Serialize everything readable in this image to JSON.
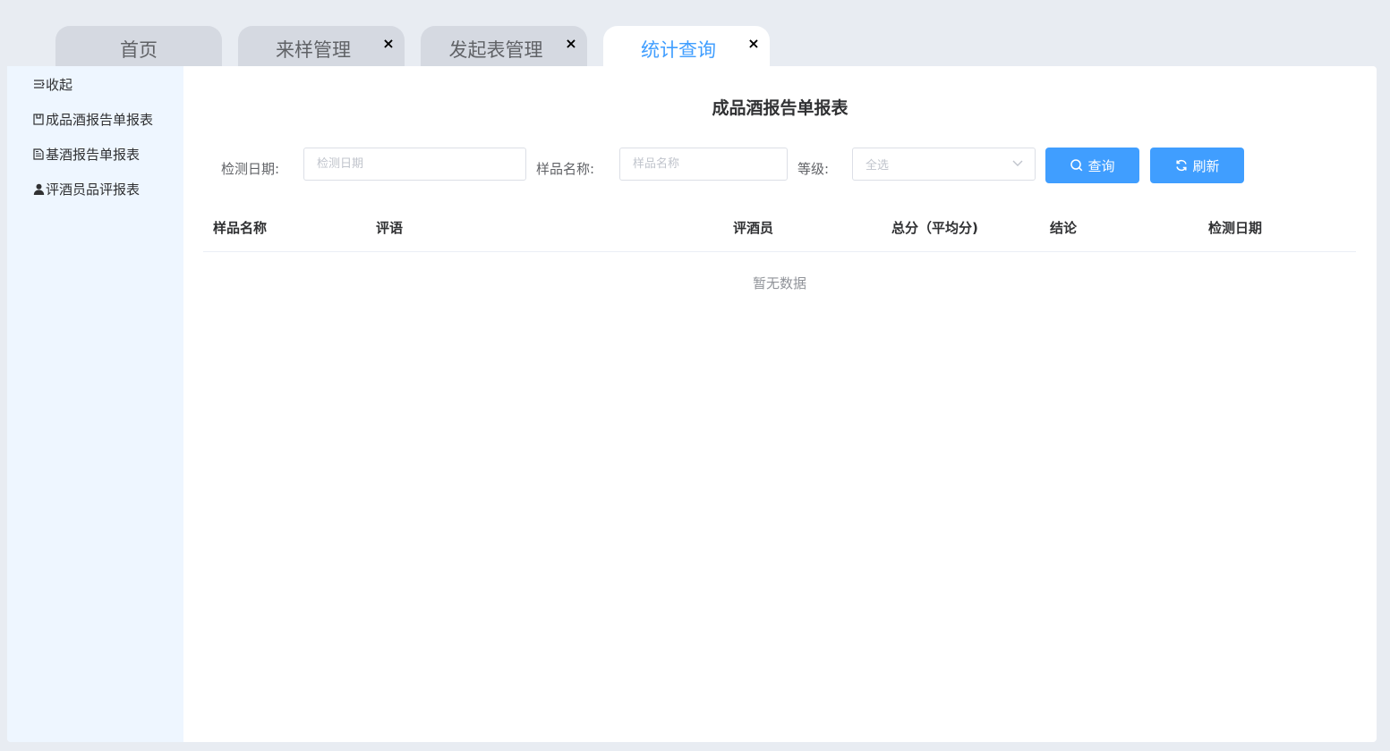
{
  "tabs": [
    {
      "label": "首页",
      "closable": false,
      "active": false
    },
    {
      "label": "来样管理",
      "closable": true,
      "active": false
    },
    {
      "label": "发起表管理",
      "closable": true,
      "active": false
    },
    {
      "label": "统计查询",
      "closable": true,
      "active": true
    }
  ],
  "tab_close_glyph": "×",
  "sidebar": {
    "items": [
      {
        "label": "收起",
        "icon": "collapse-icon"
      },
      {
        "label": "成品酒报告单报表",
        "icon": "report-icon"
      },
      {
        "label": "基酒报告单报表",
        "icon": "document-icon"
      },
      {
        "label": "评酒员品评报表",
        "icon": "user-icon"
      }
    ]
  },
  "main": {
    "title": "成品酒报告单报表",
    "filters": {
      "date_label": "检测日期:",
      "date_placeholder": "检测日期",
      "name_label": "样品名称:",
      "name_placeholder": "样品名称",
      "grade_label": "等级:",
      "grade_value": "全选"
    },
    "buttons": {
      "query": "查询",
      "refresh": "刷新"
    },
    "table": {
      "columns": [
        "样品名称",
        "评语",
        "评酒员",
        "总分（平均分)",
        "结论",
        "检测日期"
      ],
      "rows": [],
      "empty_text": "暂无数据"
    }
  },
  "colors": {
    "primary": "#409eff",
    "sidebar_bg": "#eef6ff",
    "page_bg": "#e8ecf2",
    "inactive_tab": "#d5d9e1"
  }
}
